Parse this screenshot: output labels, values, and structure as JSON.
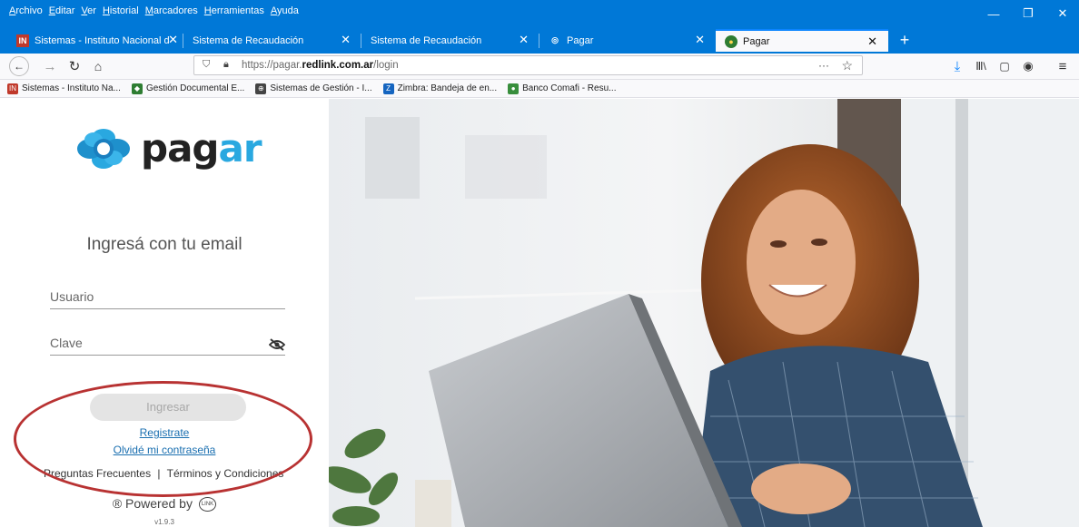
{
  "menu": [
    "Archivo",
    "Editar",
    "Ver",
    "Historial",
    "Marcadores",
    "Herramientas",
    "Ayuda"
  ],
  "tabs": [
    {
      "label": "Sistemas - Instituto Nacional d",
      "favicon": "IN",
      "active": false
    },
    {
      "label": "Sistema de Recaudación",
      "favicon": "",
      "active": false
    },
    {
      "label": "Sistema de Recaudación",
      "favicon": "",
      "active": false
    },
    {
      "label": "Pagar",
      "favicon": "◎",
      "active": false
    },
    {
      "label": "Pagar",
      "favicon": "●",
      "active": true
    }
  ],
  "url": {
    "prefix": "https://pagar.",
    "domain": "redlink.com.ar",
    "path": "/login"
  },
  "bookmarks": [
    {
      "label": "Sistemas - Instituto Na...",
      "icon_color": "#c0392b",
      "glyph": "IN"
    },
    {
      "label": "Gestión Documental E...",
      "icon_color": "#2e7d32",
      "glyph": "◆"
    },
    {
      "label": "Sistemas de Gestión - I...",
      "icon_color": "#444444",
      "glyph": "⊕"
    },
    {
      "label": "Zimbra: Bandeja de en...",
      "icon_color": "#1565c0",
      "glyph": "Z"
    },
    {
      "label": "Banco Comafi - Resu...",
      "icon_color": "#388e3c",
      "glyph": "●"
    }
  ],
  "login": {
    "logo_text_a": "pag",
    "logo_text_b": "ar",
    "heading": "Ingresá con tu email",
    "user_label": "Usuario",
    "password_label": "Clave",
    "submit_label": "Ingresar",
    "register_link": "Registrate",
    "forgot_link": "Olvidé mi contraseña",
    "faq_link": "Preguntas Frecuentes",
    "divider": "|",
    "terms_link": "Términos y Condiciones",
    "powered_by": "® Powered by",
    "link_badge": "LINK",
    "version": "v1.9.3"
  },
  "colors": {
    "chrome_blue": "#0078d7",
    "brand_blue": "#29a8e0",
    "annotation_red": "#b83232"
  }
}
